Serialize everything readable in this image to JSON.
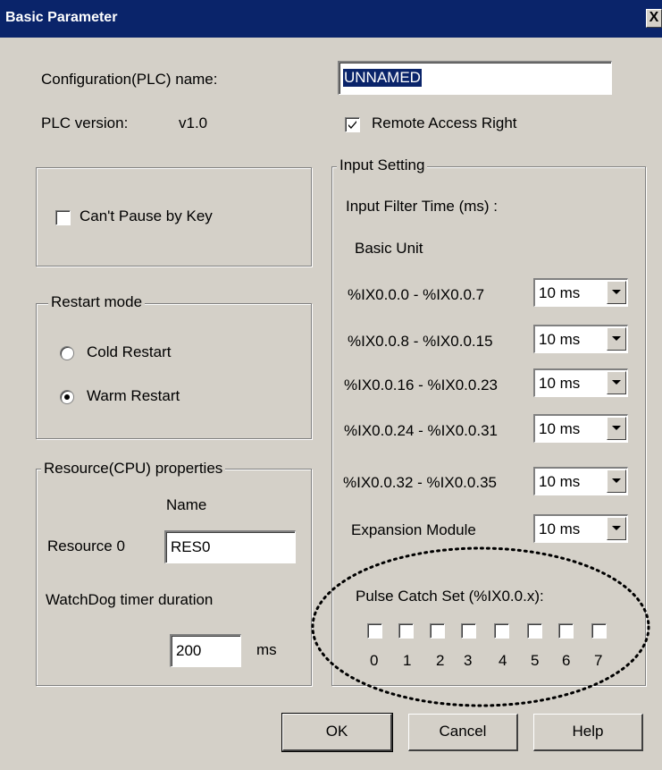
{
  "window": {
    "title": "Basic Parameter",
    "close_glyph": "X"
  },
  "config": {
    "name_label": "Configuration(PLC) name:",
    "name_value": "UNNAMED"
  },
  "plc": {
    "version_label": "PLC version:",
    "version_value": "v1.0"
  },
  "remote_access": {
    "label": "Remote Access Right",
    "checked": true
  },
  "pause": {
    "label": "Can't Pause by Key",
    "checked": false
  },
  "restart": {
    "legend": "Restart mode",
    "options": [
      {
        "label": "Cold Restart",
        "selected": false
      },
      {
        "label": "Warm Restart",
        "selected": true
      }
    ]
  },
  "resource": {
    "legend": "Resource(CPU) properties",
    "name_header": "Name",
    "resource_label": "Resource 0",
    "resource_value": "RES0",
    "watchdog_label": "WatchDog timer duration",
    "watchdog_value": "200",
    "watchdog_unit": "ms"
  },
  "input": {
    "legend": "Input Setting",
    "filter_label": "Input Filter Time (ms) :",
    "basic_unit_label": "Basic Unit",
    "rows": [
      {
        "label": "%IX0.0.0 - %IX0.0.7",
        "value": "10 ms"
      },
      {
        "label": "%IX0.0.8 - %IX0.0.15",
        "value": "10 ms"
      },
      {
        "label": "%IX0.0.16 - %IX0.0.23",
        "value": "10 ms"
      },
      {
        "label": "%IX0.0.24 - %IX0.0.31",
        "value": "10 ms"
      },
      {
        "label": "%IX0.0.32 - %IX0.0.35",
        "value": "10 ms"
      },
      {
        "label": "Expansion Module",
        "value": "10 ms"
      }
    ],
    "pulse_label": "Pulse Catch Set (%IX0.0.x):",
    "pulse_bits": [
      "0",
      "1",
      "2",
      "3",
      "4",
      "5",
      "6",
      "7"
    ]
  },
  "buttons": {
    "ok": "OK",
    "cancel": "Cancel",
    "help": "Help"
  }
}
